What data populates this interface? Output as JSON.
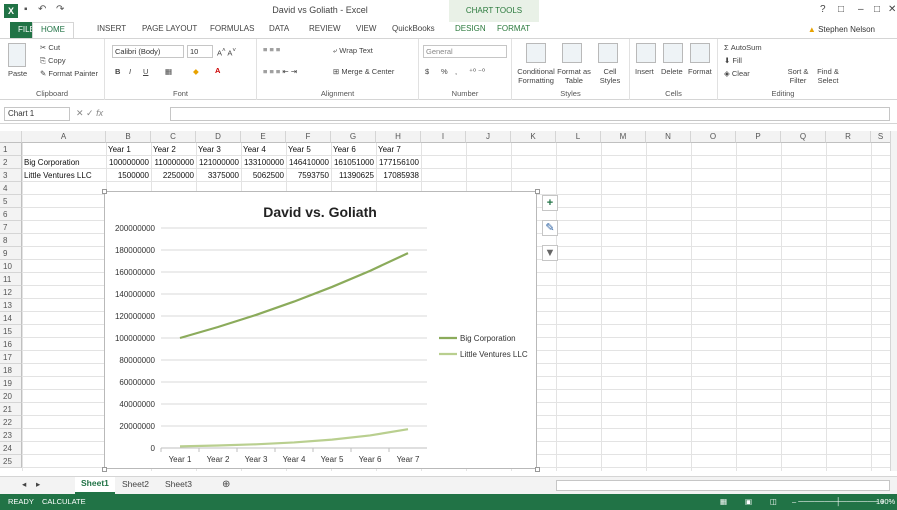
{
  "window": {
    "title": "David vs Goliath - Excel",
    "chart_tools": "CHART TOOLS",
    "user": "Stephen Nelson",
    "help": "?",
    "min": "–",
    "restore": "□",
    "close": "✕"
  },
  "tabs": [
    "FILE",
    "HOME",
    "INSERT",
    "PAGE LAYOUT",
    "FORMULAS",
    "DATA",
    "REVIEW",
    "VIEW",
    "QuickBooks",
    "DESIGN",
    "FORMAT"
  ],
  "ribbon": {
    "clipboard": {
      "label": "Clipboard",
      "paste": "Paste",
      "cut": "Cut",
      "copy": "Copy",
      "format_painter": "Format Painter"
    },
    "font": {
      "label": "Font",
      "name": "Calibri (Body)",
      "size": "10",
      "bold": "B",
      "italic": "I",
      "underline": "U"
    },
    "alignment": {
      "label": "Alignment",
      "wrap": "Wrap Text",
      "merge": "Merge & Center"
    },
    "number": {
      "label": "Number",
      "format": "General",
      "currency": "$",
      "percent": "%",
      "comma": ","
    },
    "styles": {
      "label": "Styles",
      "cond": "Conditional Formatting",
      "table": "Format as Table",
      "cell": "Cell Styles"
    },
    "cells": {
      "label": "Cells",
      "insert": "Insert",
      "delete": "Delete",
      "format": "Format"
    },
    "editing": {
      "label": "Editing",
      "autosum": "AutoSum",
      "fill": "Fill",
      "clear": "Clear",
      "sort": "Sort & Filter",
      "find": "Find & Select"
    }
  },
  "formula_bar": {
    "name_box": "Chart 1",
    "fx": "fx",
    "value": ""
  },
  "columns": [
    "A",
    "B",
    "C",
    "D",
    "E",
    "F",
    "G",
    "H",
    "I",
    "J",
    "K",
    "L",
    "M",
    "N",
    "O",
    "P",
    "Q",
    "R",
    "S"
  ],
  "rows": [
    "1",
    "2",
    "3",
    "4",
    "5",
    "6",
    "7",
    "8",
    "9",
    "10",
    "11",
    "12",
    "13",
    "14",
    "15",
    "16",
    "17",
    "18",
    "19",
    "20",
    "21",
    "22",
    "23",
    "24",
    "25"
  ],
  "table": {
    "headers": [
      "Year 1",
      "Year 2",
      "Year 3",
      "Year 4",
      "Year 5",
      "Year 6",
      "Year 7"
    ],
    "row2": [
      "Big Corporation",
      "100000000",
      "110000000",
      "121000000",
      "133100000",
      "146410000",
      "161051000",
      "177156100"
    ],
    "row3": [
      "Little Ventures LLC",
      "1500000",
      "2250000",
      "3375000",
      "5062500",
      "7593750",
      "11390625",
      "17085938"
    ]
  },
  "chart_data": {
    "type": "line",
    "title": "David vs. Goliath",
    "categories": [
      "Year 1",
      "Year 2",
      "Year 3",
      "Year 4",
      "Year 5",
      "Year 6",
      "Year 7"
    ],
    "series": [
      {
        "name": "Big Corporation",
        "values": [
          100000000,
          110000000,
          121000000,
          133100000,
          146410000,
          161051000,
          177156100
        ],
        "color": "#8bab5b"
      },
      {
        "name": "Little Ventures LLC",
        "values": [
          1500000,
          2250000,
          3375000,
          5062500,
          7593750,
          11390625,
          17085938
        ],
        "color": "#b9cf8f"
      }
    ],
    "yticks": [
      "0",
      "20000000",
      "40000000",
      "60000000",
      "80000000",
      "100000000",
      "120000000",
      "140000000",
      "160000000",
      "180000000",
      "200000000"
    ],
    "ylim": [
      0,
      200000000
    ],
    "grid": true,
    "legend": "right"
  },
  "sheets": [
    "Sheet1",
    "Sheet2",
    "Sheet3"
  ],
  "add_sheet": "⊕",
  "status": {
    "ready": "READY",
    "calc": "CALCULATE",
    "zoom": "100%"
  }
}
